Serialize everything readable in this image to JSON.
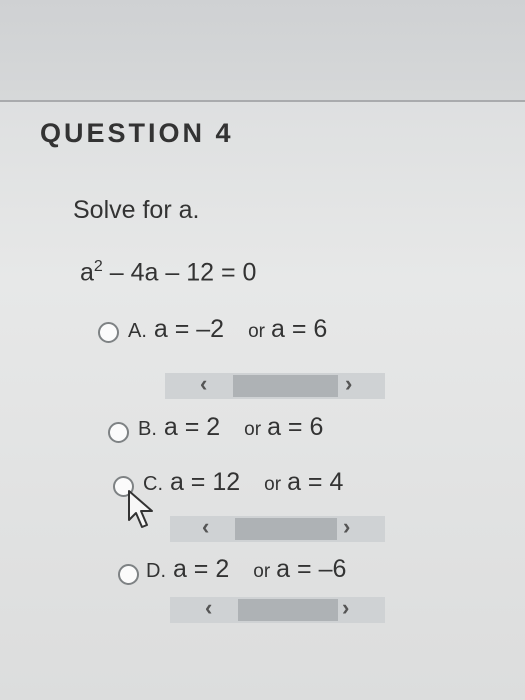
{
  "question": {
    "title": "QUESTION 4",
    "prompt": "Solve for a.",
    "equation_base": "a",
    "equation_exp": "2",
    "equation_rest": " – 4a – 12 = 0"
  },
  "options": [
    {
      "letter": "A.",
      "first": "a = –2",
      "or": "or",
      "second": "a = 6"
    },
    {
      "letter": "B.",
      "first": "a = 2",
      "or": "or",
      "second": "a = 6"
    },
    {
      "letter": "C.",
      "first": "a = 12",
      "or": "or",
      "second": "a = 4"
    },
    {
      "letter": "D.",
      "first": "a = 2",
      "or": "or",
      "second": "a = –6"
    }
  ],
  "scroll_arrows": {
    "left": "‹",
    "right": "›"
  },
  "icons": [
    "radio-icon",
    "scroll-left-icon",
    "scroll-right-icon",
    "mouse-pointer-icon"
  ]
}
